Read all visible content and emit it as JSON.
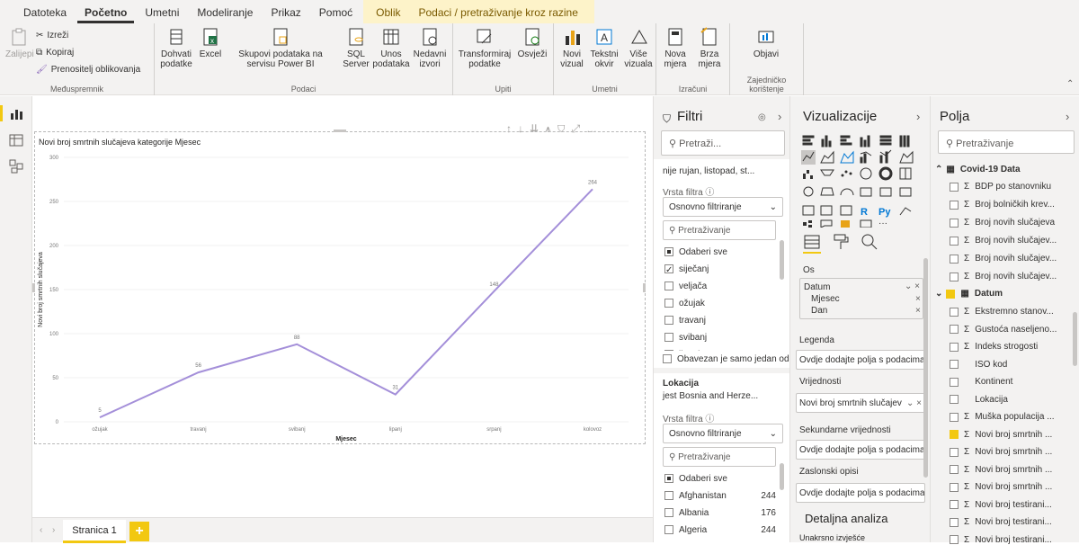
{
  "menu": {
    "tabs": [
      "Datoteka",
      "Početno",
      "Umetni",
      "Modeliranje",
      "Prikaz",
      "Pomoć"
    ],
    "active": "Početno",
    "context_tabs": [
      "Oblik",
      "Podaci / pretraživanje kroz razine"
    ]
  },
  "ribbon": {
    "clipboard": {
      "paste": "Zalijepi",
      "cut": "Izreži",
      "copy": "Kopiraj",
      "format_painter": "Prenositelj oblikovanja",
      "label": "Međuspremnik"
    },
    "data": {
      "get_data": "Dohvati podatke",
      "excel": "Excel",
      "pbi_datasets": "Skupovi podataka na servisu Power BI",
      "sql": "SQL Server",
      "enter_data": "Unos podataka",
      "recent": "Nedavni izvori",
      "label": "Podaci"
    },
    "queries": {
      "transform": "Transformiraj podatke",
      "refresh": "Osvježi",
      "label": "Upiti"
    },
    "insert": {
      "new_visual": "Novi vizual",
      "text_box": "Tekstni okvir",
      "more_visuals": "Više vizuala",
      "label": "Umetni"
    },
    "calculations": {
      "new_measure": "Nova mjera",
      "quick_measure": "Brza mjera",
      "label": "Izračuni"
    },
    "share": {
      "publish": "Objavi",
      "label": "Zajedničko korištenje"
    }
  },
  "canvas": {
    "page_tab": "Stranica 1",
    "add_page": "+"
  },
  "chart_data": {
    "type": "line",
    "title": "Novi broj smrtnih slučajeva kategorije Mjesec",
    "xlabel": "Mjesec",
    "ylabel": "Novi broj smrtnih slučajeva",
    "categories": [
      "ožujak",
      "travanj",
      "svibanj",
      "lipanj",
      "srpanj",
      "kolovoz"
    ],
    "values": [
      5,
      56,
      88,
      31,
      148,
      264
    ],
    "data_labels": [
      "5",
      "56",
      "88",
      "31",
      "148",
      "264"
    ],
    "ylim": [
      0,
      300
    ],
    "yticks": [
      "0",
      "50",
      "100",
      "150",
      "200",
      "250",
      "300"
    ],
    "color": "#a48fd9"
  },
  "filters": {
    "title": "Filtri",
    "search_placeholder": "Pretraži...",
    "card1": {
      "summary": "nije rujan, listopad, st...",
      "filter_type_label": "Vrsta filtra",
      "filter_type": "Osnovno filtriranje",
      "search_placeholder": "Pretraživanje",
      "select_all": "Odaberi sve",
      "items": [
        "siječanj",
        "veljača",
        "ožujak",
        "travanj",
        "svibanj",
        "lipanj"
      ],
      "require_single": "Obavezan je samo jedan oda"
    },
    "card2": {
      "title": "Lokacija",
      "summary": "jest Bosnia and Herze...",
      "filter_type_label": "Vrsta filtra",
      "filter_type": "Osnovno filtriranje",
      "search_placeholder": "Pretraživanje",
      "select_all": "Odaberi sve",
      "items": [
        {
          "name": "Afghanistan",
          "count": "244"
        },
        {
          "name": "Albania",
          "count": "176"
        },
        {
          "name": "Algeria",
          "count": "244"
        }
      ]
    }
  },
  "viz": {
    "title": "Vizualizacije",
    "axis_label": "Os",
    "axis_fields": [
      "Datum",
      "Mjesec",
      "Dan"
    ],
    "legend_label": "Legenda",
    "add_placeholder": "Ovdje dodajte polja s podacima",
    "values_label": "Vrijednosti",
    "values_field": "Novi broj smrtnih slučajev",
    "secondary_label": "Sekundarne vrijednosti",
    "tooltips_label": "Zaslonski opisi",
    "drillthrough_title": "Detaljna analiza",
    "drill_sub": "Unakrsno izvješće"
  },
  "fields": {
    "title": "Polja",
    "search_placeholder": "Pretraživanje",
    "table1": "Covid-19 Data",
    "table1_fields": [
      "BDP po stanovniku",
      "Broj bolničkih krev...",
      "Broj novih slučajeva",
      "Broj novih slučajev...",
      "Broj novih slučajev...",
      "Broj novih slučajev..."
    ],
    "table2": "Datum",
    "table2_fields": [
      {
        "name": "Ekstremno stanov...",
        "sigma": true,
        "checked": false
      },
      {
        "name": "Gustoća naseljeno...",
        "sigma": true,
        "checked": false
      },
      {
        "name": "Indeks strogosti",
        "sigma": true,
        "checked": false
      },
      {
        "name": "ISO kod",
        "sigma": false,
        "checked": false
      },
      {
        "name": "Kontinent",
        "sigma": false,
        "checked": false
      },
      {
        "name": "Lokacija",
        "sigma": false,
        "checked": false
      },
      {
        "name": "Muška populacija ...",
        "sigma": true,
        "checked": false
      },
      {
        "name": "Novi broj smrtnih ...",
        "sigma": true,
        "checked": true
      },
      {
        "name": "Novi broj smrtnih ...",
        "sigma": true,
        "checked": false
      },
      {
        "name": "Novi broj smrtnih ...",
        "sigma": true,
        "checked": false
      },
      {
        "name": "Novi broj smrtnih ...",
        "sigma": true,
        "checked": false
      },
      {
        "name": "Novi broj testirani...",
        "sigma": true,
        "checked": false
      },
      {
        "name": "Novi broj testirani...",
        "sigma": true,
        "checked": false
      },
      {
        "name": "Novi broj testirani...",
        "sigma": true,
        "checked": false
      }
    ]
  }
}
